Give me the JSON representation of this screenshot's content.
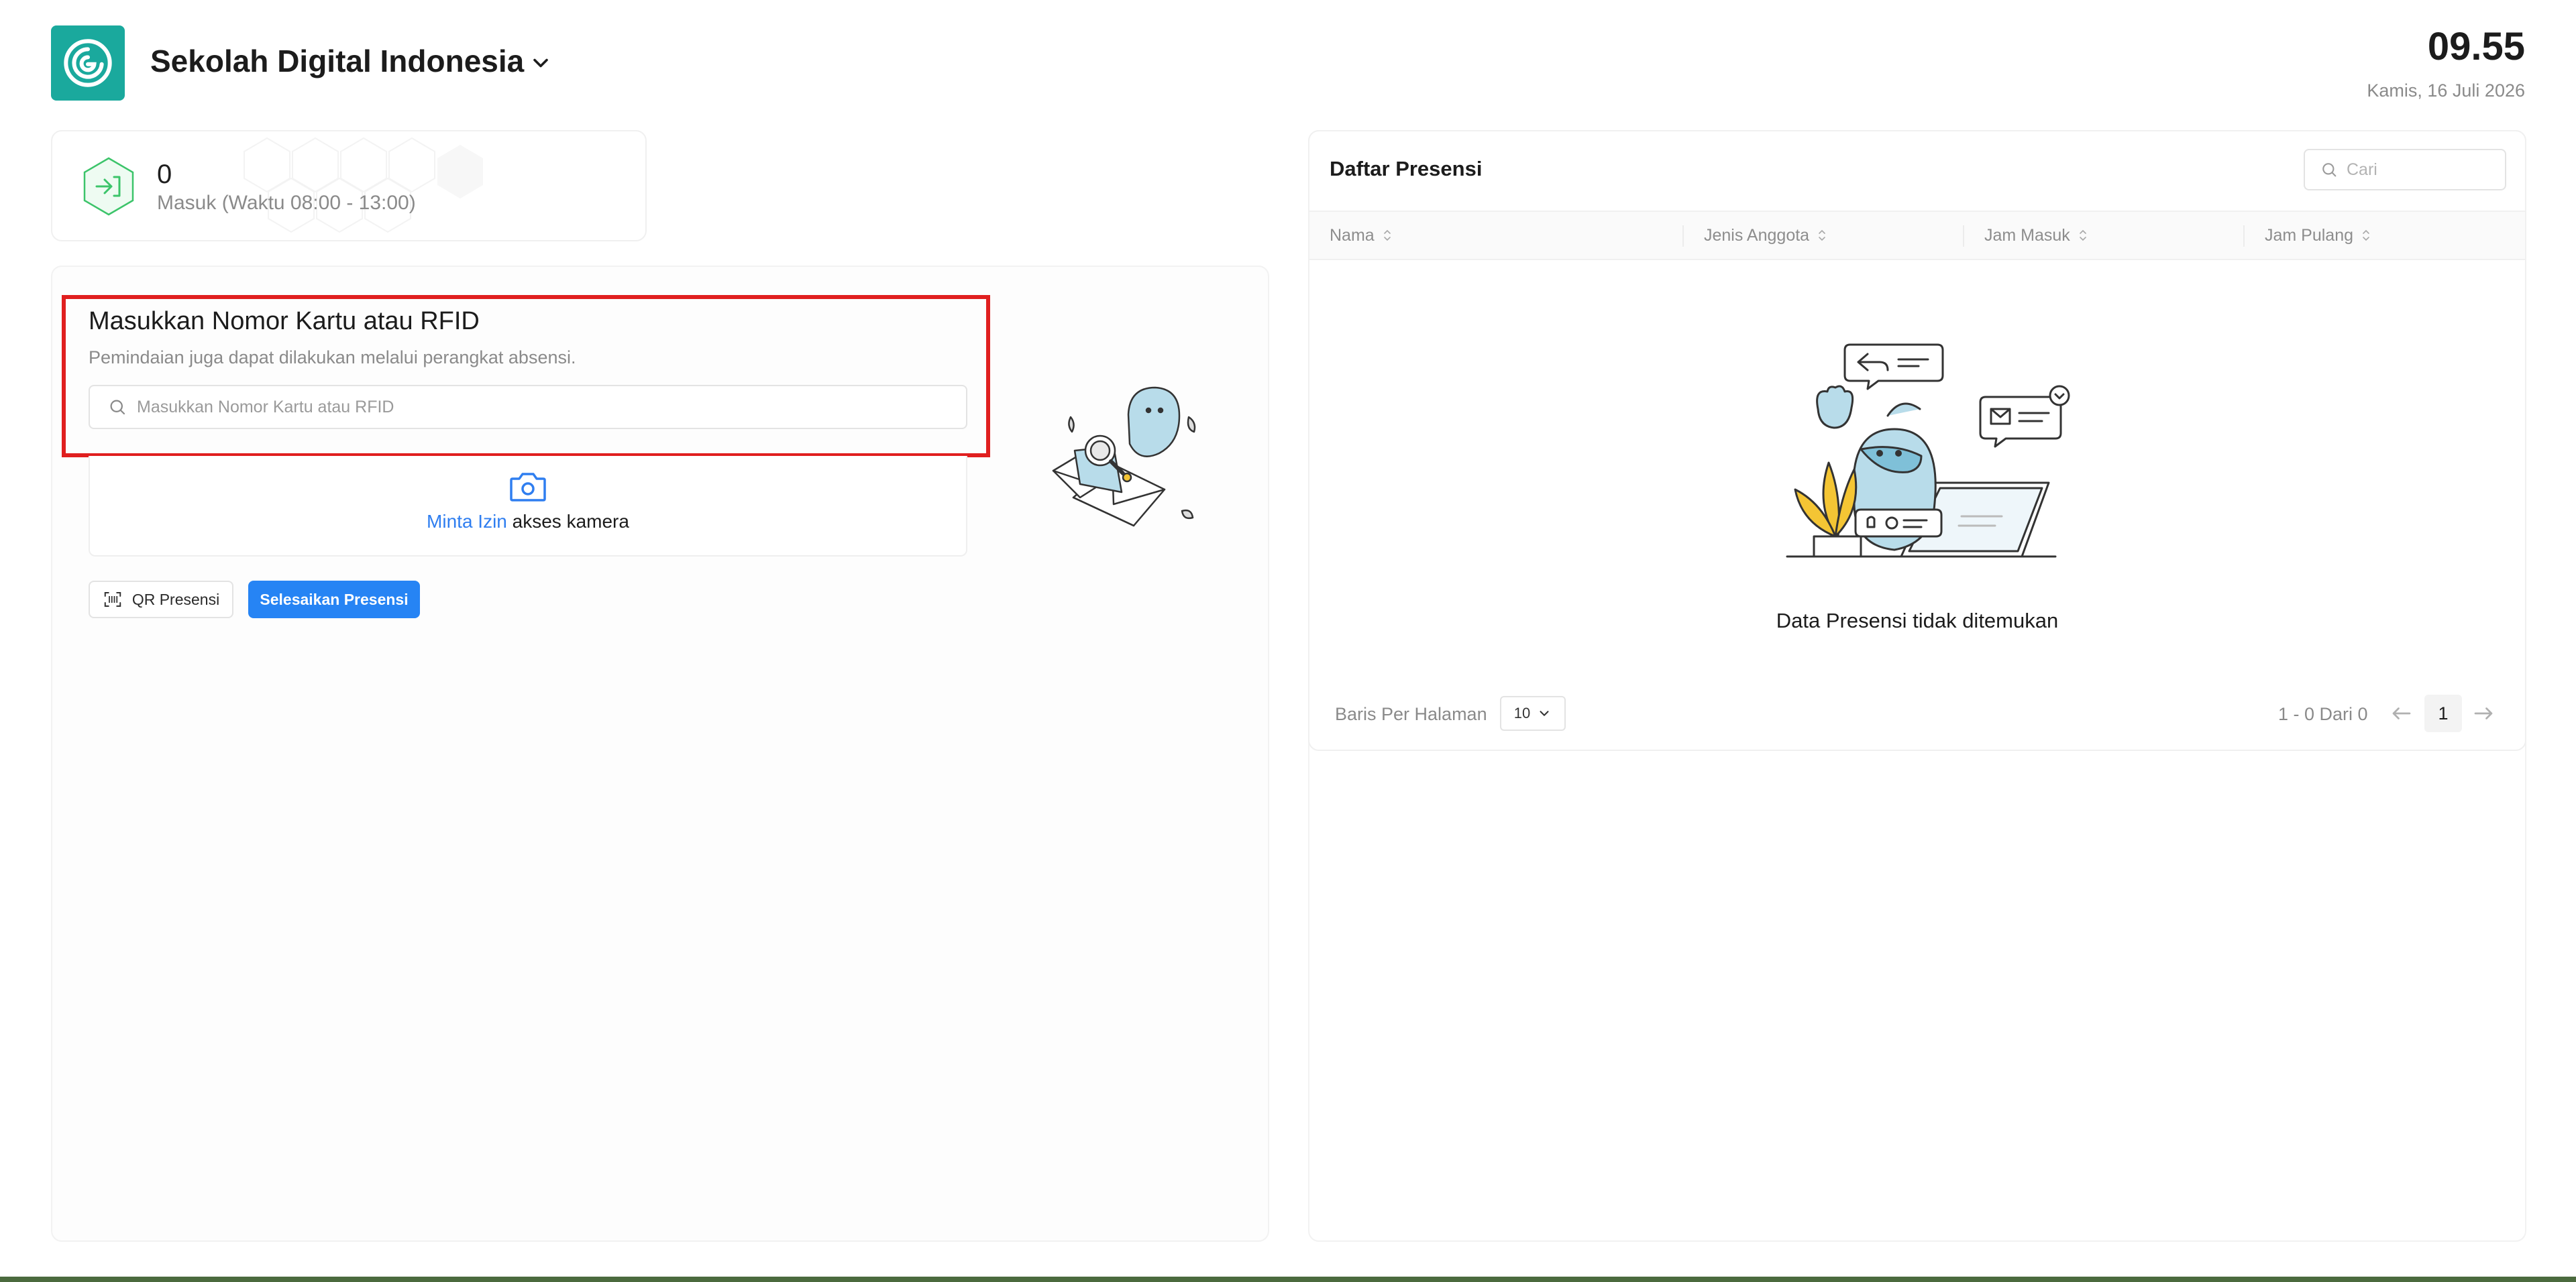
{
  "header": {
    "school_name": "Sekolah Digital Indonesia",
    "time": "09.55",
    "date": "Kamis, 16 Juli 2026"
  },
  "stat": {
    "value": "0",
    "label": "Masuk (Waktu 08:00 - 13:00)",
    "icon": "login-arrow-icon"
  },
  "rfid": {
    "title": "Masukkan Nomor Kartu atau RFID",
    "subtitle": "Pemindaian juga dapat dilakukan melalui perangkat absensi.",
    "placeholder": "Masukkan Nomor Kartu atau RFID",
    "value": ""
  },
  "camera": {
    "link_text": "Minta Izin",
    "rest_text": " akses kamera"
  },
  "buttons": {
    "qr_label": "QR Presensi",
    "finish_label": "Selesaikan Presensi"
  },
  "attendance_list": {
    "title": "Daftar Presensi",
    "search_placeholder": "Cari",
    "columns": [
      "Nama",
      "Jenis Anggota",
      "Jam Masuk",
      "Jam Pulang"
    ],
    "empty_text": "Data Presensi tidak ditemukan"
  },
  "pagination": {
    "rows_label": "Baris Per Halaman",
    "rows_value": "10",
    "range_text": "1 - 0 Dari 0",
    "current_page": "1"
  },
  "colors": {
    "brand": "#1aa99d",
    "primary": "#2684f4",
    "highlight": "#e01f1f",
    "success": "#3cc46a"
  }
}
